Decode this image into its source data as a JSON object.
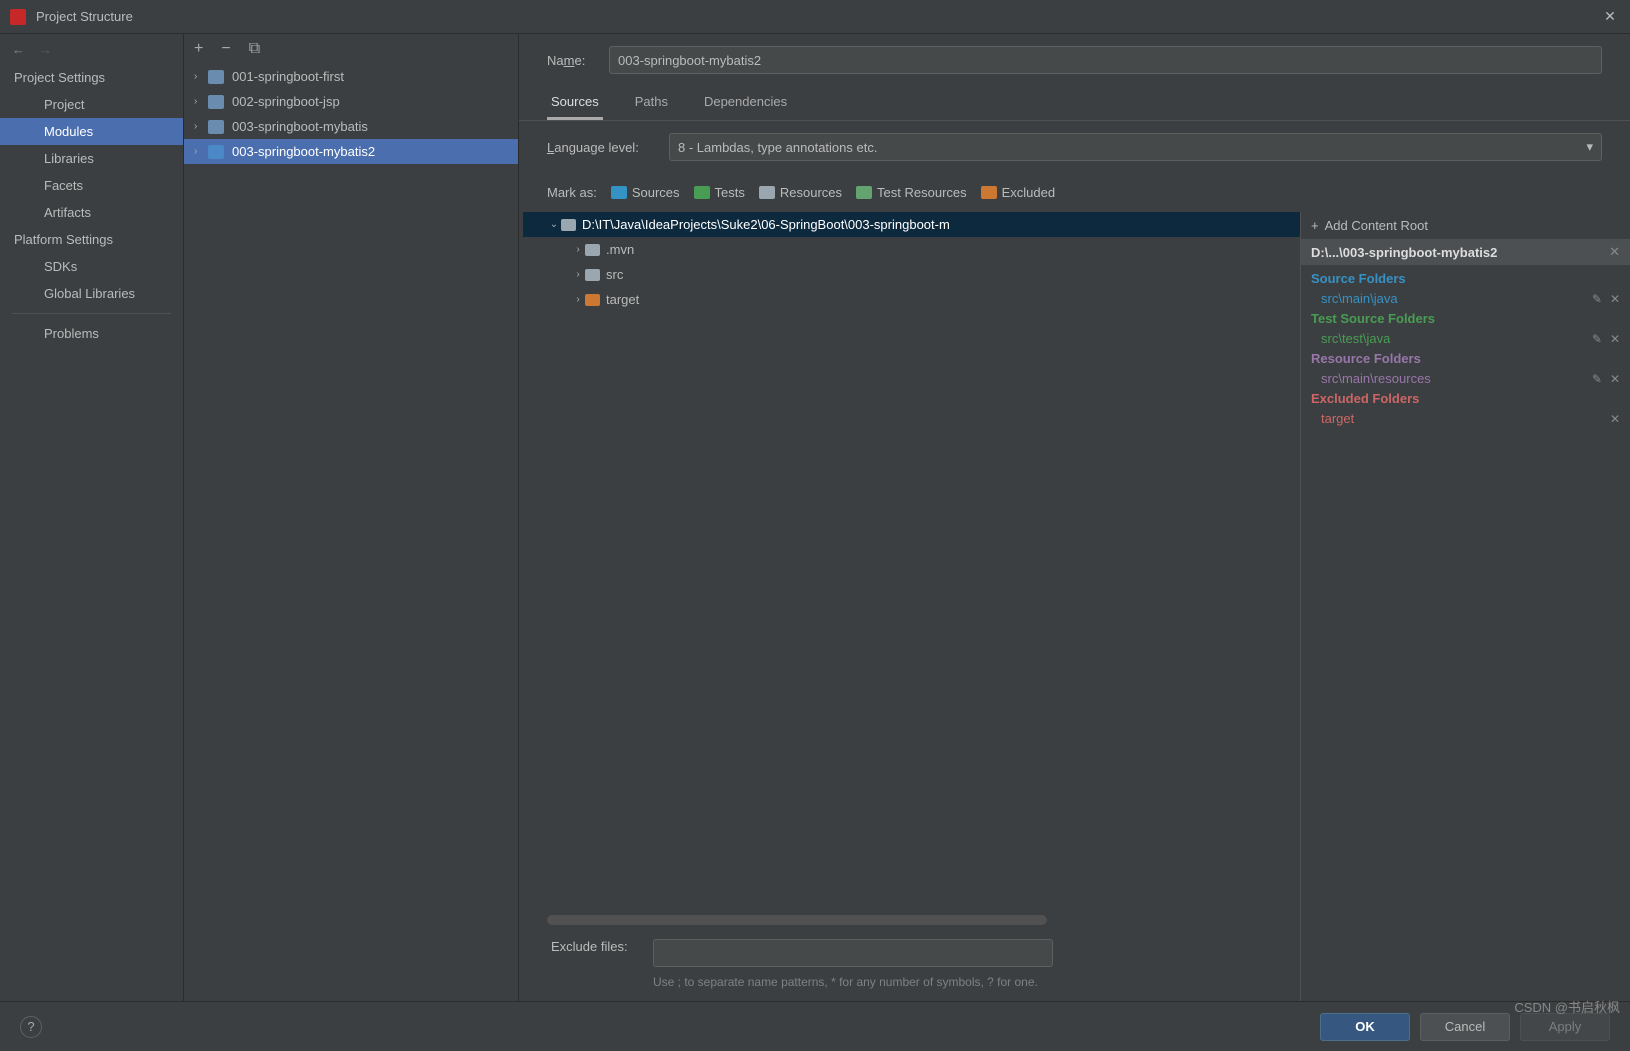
{
  "window": {
    "title": "Project Structure"
  },
  "sidebar": {
    "section1": "Project Settings",
    "items1": [
      "Project",
      "Modules",
      "Libraries",
      "Facets",
      "Artifacts"
    ],
    "section2": "Platform Settings",
    "items2": [
      "SDKs",
      "Global Libraries"
    ],
    "problems": "Problems"
  },
  "modules": {
    "items": [
      {
        "label": "001-springboot-first"
      },
      {
        "label": "002-springboot-jsp"
      },
      {
        "label": "003-springboot-mybatis"
      },
      {
        "label": "003-springboot-mybatis2"
      }
    ]
  },
  "form": {
    "name_label": "Name:",
    "name_value": "003-springboot-mybatis2",
    "tabs": [
      "Sources",
      "Paths",
      "Dependencies"
    ],
    "lang_label": "Language level:",
    "lang_value": "8 - Lambdas, type annotations etc.",
    "mark_label": "Mark as:",
    "mark_items": [
      {
        "label": "Sources",
        "color": "blue",
        "u": "S"
      },
      {
        "label": "Tests",
        "color": "green",
        "u": "T"
      },
      {
        "label": "Resources",
        "color": "gray",
        "u": "R"
      },
      {
        "label": "Test Resources",
        "color": "teal",
        "u": ""
      },
      {
        "label": "Excluded",
        "color": "orange",
        "u": "E"
      }
    ]
  },
  "filetree": {
    "root": "D:\\IT\\Java\\IdeaProjects\\Suke2\\06-SpringBoot\\003-springboot-m",
    "children": [
      {
        "label": ".mvn",
        "icon": "gray"
      },
      {
        "label": "src",
        "icon": "gray"
      },
      {
        "label": "target",
        "icon": "orange"
      }
    ]
  },
  "contentRoots": {
    "addLabel": "Add Content Root",
    "path": "D:\\...\\003-springboot-mybatis2",
    "groups": [
      {
        "title": "Source Folders",
        "cls": "c-blue",
        "items": [
          {
            "path": "src\\main\\java"
          }
        ]
      },
      {
        "title": "Test Source Folders",
        "cls": "c-green",
        "items": [
          {
            "path": "src\\test\\java"
          }
        ]
      },
      {
        "title": "Resource Folders",
        "cls": "c-purple",
        "items": [
          {
            "path": "src\\main\\resources"
          }
        ]
      },
      {
        "title": "Excluded Folders",
        "cls": "c-red",
        "items": [
          {
            "path": "target"
          }
        ]
      }
    ]
  },
  "exclude": {
    "label": "Exclude files:",
    "hint": "Use ; to separate name patterns, * for any number of symbols, ? for one."
  },
  "buttons": {
    "ok": "OK",
    "cancel": "Cancel",
    "apply": "Apply"
  },
  "watermark": "CSDN @书启秋枫"
}
